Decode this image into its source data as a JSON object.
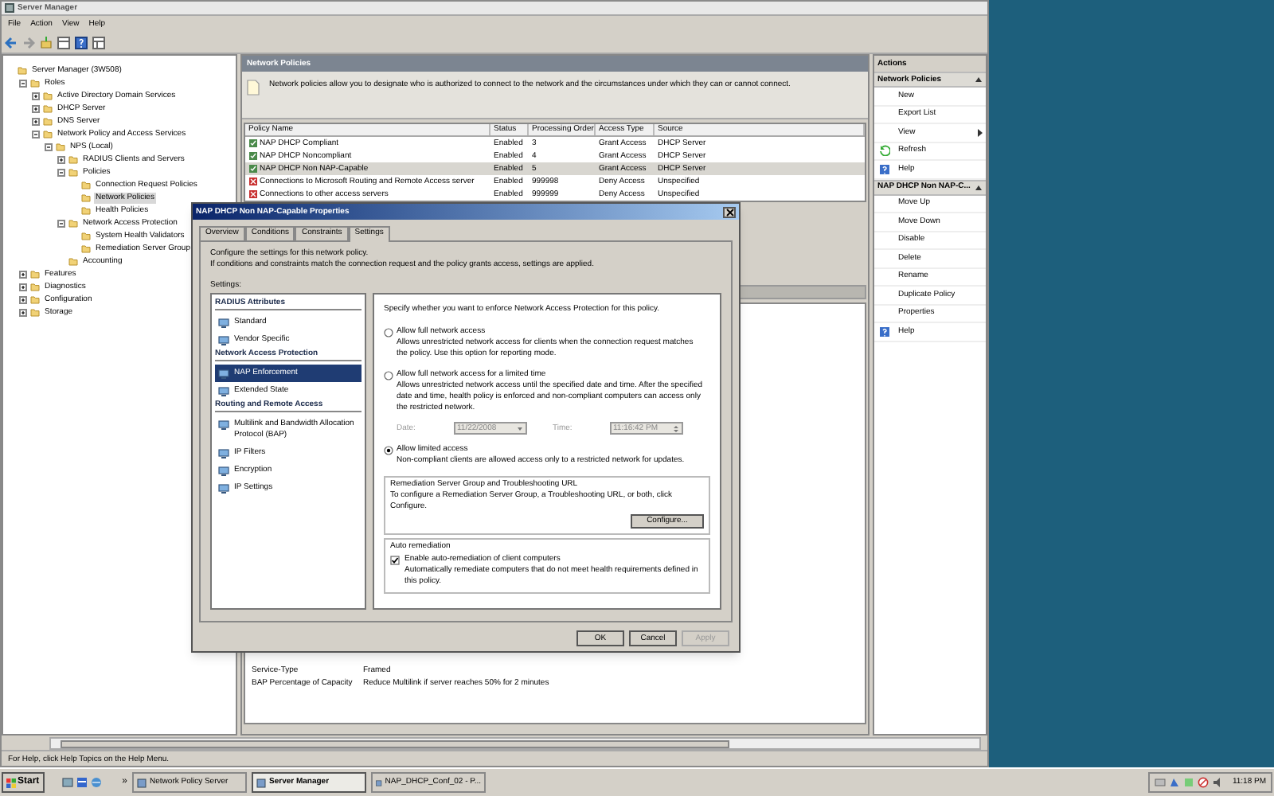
{
  "window": {
    "title": "Server Manager"
  },
  "menu": [
    "File",
    "Action",
    "View",
    "Help"
  ],
  "tree": [
    {
      "label": "Server Manager (3W508)",
      "selected": false,
      "children": [
        {
          "label": "Roles",
          "selected": false,
          "expanded": true,
          "children": [
            {
              "label": "Active Directory Domain Services",
              "selected": false,
              "expanded": false
            },
            {
              "label": "DHCP Server",
              "selected": false,
              "expanded": false
            },
            {
              "label": "DNS Server",
              "selected": false,
              "expanded": false
            },
            {
              "label": "Network Policy and Access Services",
              "selected": false,
              "expanded": true,
              "children": [
                {
                  "label": "NPS (Local)",
                  "selected": false,
                  "expanded": true,
                  "children": [
                    {
                      "label": "RADIUS Clients and Servers",
                      "selected": false,
                      "expanded": false
                    },
                    {
                      "label": "Policies",
                      "selected": false,
                      "expanded": true,
                      "children": [
                        {
                          "label": "Connection Request Policies",
                          "selected": false
                        },
                        {
                          "label": "Network Policies",
                          "selected": true
                        },
                        {
                          "label": "Health Policies",
                          "selected": false
                        }
                      ]
                    },
                    {
                      "label": "Network Access Protection",
                      "selected": false,
                      "expanded": true,
                      "children": [
                        {
                          "label": "System Health Validators",
                          "selected": false
                        },
                        {
                          "label": "Remediation Server Group",
                          "selected": false
                        }
                      ]
                    },
                    {
                      "label": "Accounting",
                      "selected": false
                    }
                  ]
                }
              ]
            }
          ]
        },
        {
          "label": "Features",
          "selected": false,
          "expanded": false
        },
        {
          "label": "Diagnostics",
          "selected": false,
          "expanded": false
        },
        {
          "label": "Configuration",
          "selected": false,
          "expanded": false
        },
        {
          "label": "Storage",
          "selected": false,
          "expanded": false
        }
      ]
    }
  ],
  "policies": {
    "title": "Network Policies",
    "description": "Network policies allow you to designate who is authorized to connect to the network and the circumstances under which they can or cannot connect.",
    "columns": [
      "Policy Name",
      "Status",
      "Processing Order",
      "Access Type",
      "Source"
    ],
    "rows": [
      {
        "kind": "grant",
        "selected": false,
        "cells": [
          "NAP DHCP Compliant",
          "Enabled",
          "3",
          "Grant Access",
          "DHCP Server"
        ]
      },
      {
        "kind": "grant",
        "selected": false,
        "cells": [
          "NAP DHCP Noncompliant",
          "Enabled",
          "4",
          "Grant Access",
          "DHCP Server"
        ]
      },
      {
        "kind": "grant",
        "selected": true,
        "cells": [
          "NAP DHCP Non NAP-Capable",
          "Enabled",
          "5",
          "Grant Access",
          "DHCP Server"
        ]
      },
      {
        "kind": "deny",
        "selected": false,
        "cells": [
          "Connections to Microsoft Routing and Remote Access server",
          "Enabled",
          "999998",
          "Deny Access",
          "Unspecified"
        ]
      },
      {
        "kind": "deny",
        "selected": false,
        "cells": [
          "Connections to other access servers",
          "Enabled",
          "999999",
          "Deny Access",
          "Unspecified"
        ]
      }
    ],
    "details": [
      {
        "name": "Service-Type",
        "value": "Framed"
      },
      {
        "name": "BAP Percentage of Capacity",
        "value": "Reduce Multilink if server reaches 50% for 2 minutes"
      }
    ]
  },
  "actions": {
    "title": "Actions",
    "sections": [
      {
        "title": "Network Policies",
        "items": [
          {
            "label": "New",
            "kind": "plain"
          },
          {
            "label": "Export List",
            "kind": "plain"
          },
          {
            "label": "View",
            "kind": "submenu"
          },
          {
            "label": "Refresh",
            "kind": "refresh"
          },
          {
            "label": "Help",
            "kind": "help"
          }
        ]
      },
      {
        "title": "NAP DHCP Non NAP-C...",
        "items": [
          {
            "label": "Move Up",
            "kind": "plain"
          },
          {
            "label": "Move Down",
            "kind": "plain"
          },
          {
            "label": "Disable",
            "kind": "plain"
          },
          {
            "label": "Delete",
            "kind": "plain"
          },
          {
            "label": "Rename",
            "kind": "plain"
          },
          {
            "label": "Duplicate Policy",
            "kind": "plain"
          },
          {
            "label": "Properties",
            "kind": "plain"
          },
          {
            "label": "Help",
            "kind": "help"
          }
        ]
      }
    ]
  },
  "status_bar": "For Help, click Help Topics on the Help Menu.",
  "dialog": {
    "title": "NAP DHCP Non NAP-Capable Properties",
    "tabs": [
      {
        "label": "Overview",
        "selected": false
      },
      {
        "label": "Conditions",
        "selected": false
      },
      {
        "label": "Constraints",
        "selected": false
      },
      {
        "label": "Settings",
        "selected": true
      }
    ],
    "intro": [
      "Configure the settings for this network policy.",
      "If conditions and constraints match the connection request and the policy grants access, settings are applied."
    ],
    "settings_label": "Settings:",
    "groups": [
      {
        "title": "RADIUS Attributes",
        "items": [
          {
            "label": "Standard",
            "selected": false
          },
          {
            "label": "Vendor Specific",
            "selected": false
          }
        ]
      },
      {
        "title": "Network Access Protection",
        "items": [
          {
            "label": "NAP Enforcement",
            "selected": true
          },
          {
            "label": "Extended State",
            "selected": false
          }
        ]
      },
      {
        "title": "Routing and Remote Access",
        "items": [
          {
            "label": "Multilink and Bandwidth Allocation Protocol (BAP)",
            "selected": false
          },
          {
            "label": "IP Filters",
            "selected": false
          },
          {
            "label": "Encryption",
            "selected": false
          },
          {
            "label": "IP Settings",
            "selected": false
          }
        ]
      }
    ],
    "panel": {
      "prompt": "Specify whether you want to enforce Network Access Protection for this policy.",
      "options": [
        {
          "label": "Allow full network access",
          "selected": false,
          "description": "Allows unrestricted network access for clients when the connection request matches the policy.  Use this option for reporting mode."
        },
        {
          "label": "Allow full network access for a limited time",
          "selected": false,
          "description": "Allows unrestricted network access until the specified date and time.  After the specified date and time, health policy is enforced and non-compliant computers can access only the restricted network.",
          "date": {
            "label": "Date:",
            "value": "11/22/2008",
            "disabled": true
          },
          "time": {
            "label": "Time:",
            "value": "11:16:42 PM",
            "disabled": true
          }
        },
        {
          "label": "Allow limited access",
          "selected": true,
          "description": "Non-compliant clients are allowed access only to a restricted network for updates."
        }
      ],
      "remediation": {
        "title": "Remediation Server Group and Troubleshooting URL",
        "text": "To configure a Remediation Server Group, a Troubleshooting URL, or both, click Configure.",
        "button": "Configure..."
      },
      "auto_remediation": {
        "title": "Auto remediation",
        "checkbox": {
          "label": "Enable auto-remediation of client computers",
          "checked": true
        },
        "description": "Automatically remediate computers that do not meet health requirements defined in this policy."
      }
    },
    "buttons": [
      {
        "label": "OK",
        "disabled": false
      },
      {
        "label": "Cancel",
        "disabled": false
      },
      {
        "label": "Apply",
        "disabled": true
      }
    ]
  },
  "taskbar": {
    "start": "Start",
    "overflow": "»",
    "tasks": [
      {
        "label": "Network Policy Server",
        "selected": false
      },
      {
        "label": "Server Manager",
        "selected": true
      },
      {
        "label": "NAP_DHCP_Conf_02 - P...",
        "selected": false
      }
    ],
    "clock": "11:18 PM"
  }
}
